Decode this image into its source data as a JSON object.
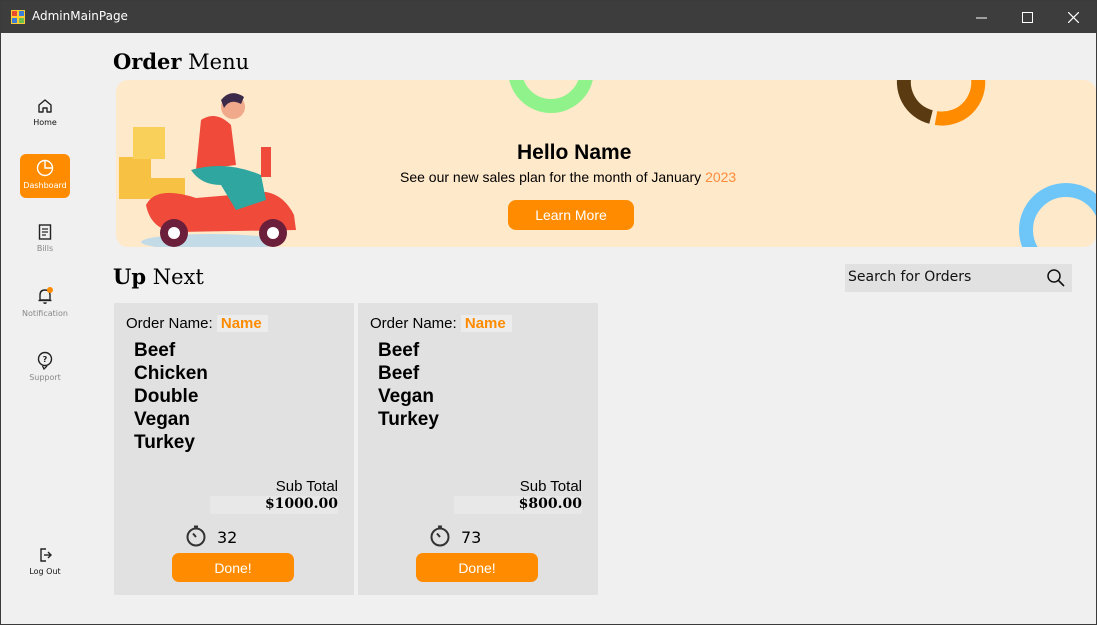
{
  "window": {
    "title": "AdminMainPage"
  },
  "sidebar": {
    "items": [
      {
        "label": "Home",
        "icon": "home-icon"
      },
      {
        "label": "Dashboard",
        "icon": "pie-chart-icon",
        "active": true
      },
      {
        "label": "Bills",
        "icon": "bill-icon"
      },
      {
        "label": "Notification",
        "icon": "bell-icon"
      },
      {
        "label": "Support",
        "icon": "support-icon"
      }
    ],
    "logout": {
      "label": "Log Out",
      "icon": "logout-icon"
    }
  },
  "header": {
    "title_bold": "Order",
    "title_regular": "Menu"
  },
  "banner": {
    "greeting": "Hello Name",
    "subtitle_prefix": "See our new sales plan for the month of January",
    "year": "2023",
    "button_label": "Learn More"
  },
  "upnext": {
    "title_bold": "Up",
    "title_regular": "Next"
  },
  "search": {
    "placeholder": "Search for Orders",
    "value": "Search for Orders"
  },
  "orders": [
    {
      "name_label": "Order Name:",
      "name": "Name",
      "items": [
        "Beef",
        "Chicken",
        "Double",
        "Vegan",
        "Turkey"
      ],
      "subtotal_label": "Sub Total",
      "subtotal": "$1000.00",
      "timer": "32",
      "button_label": "Done!"
    },
    {
      "name_label": "Order Name:",
      "name": "Name",
      "items": [
        "Beef",
        "Beef",
        "Vegan",
        "Turkey"
      ],
      "subtotal_label": "Sub Total",
      "subtotal": "$800.00",
      "timer": "73",
      "button_label": "Done!"
    }
  ],
  "colors": {
    "accent": "#ff8c00",
    "banner_bg": "#ffe9cb",
    "titlebar": "#3d3d3d",
    "panel": "#e1e1e1"
  }
}
